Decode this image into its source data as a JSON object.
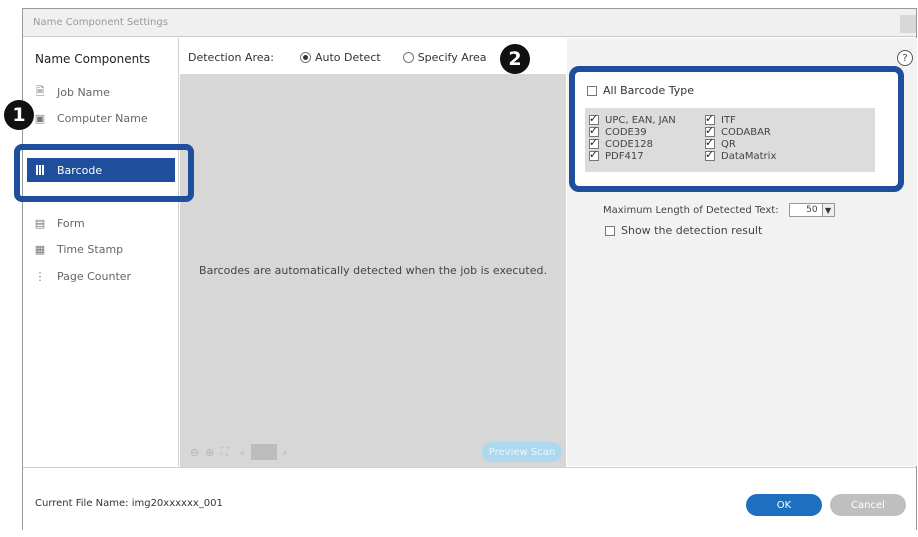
{
  "window": {
    "title": "Name Component Settings"
  },
  "sidebar": {
    "header": "Name Components",
    "items": [
      {
        "label": "Job Name",
        "icon": "document-icon"
      },
      {
        "label": "Computer Name",
        "icon": "computer-icon"
      },
      {
        "label": "Barcode",
        "icon": "barcode-icon",
        "selected": true
      },
      {
        "label": "Form",
        "icon": "form-icon"
      },
      {
        "label": "Time Stamp",
        "icon": "calendar-icon"
      },
      {
        "label": "Page Counter",
        "icon": "counter-icon"
      }
    ]
  },
  "detection": {
    "label": "Detection Area:",
    "options": [
      {
        "label": "Auto Detect",
        "selected": true
      },
      {
        "label": "Specify Area",
        "selected": false
      }
    ]
  },
  "preview": {
    "message": "Barcodes are automatically detected when the job is executed.",
    "scan_button": "Preview Scan"
  },
  "barcode_settings": {
    "all_types_label": "All Barcode Type",
    "all_types_checked": false,
    "types_left": [
      {
        "label": "UPC, EAN, JAN",
        "checked": true
      },
      {
        "label": "CODE39",
        "checked": true
      },
      {
        "label": "CODE128",
        "checked": true
      },
      {
        "label": "PDF417",
        "checked": true
      }
    ],
    "types_right": [
      {
        "label": "ITF",
        "checked": true
      },
      {
        "label": "CODABAR",
        "checked": true
      },
      {
        "label": "QR",
        "checked": true
      },
      {
        "label": "DataMatrix",
        "checked": true
      }
    ],
    "max_length_label": "Maximum Length of Detected Text:",
    "max_length_value": "50",
    "show_result_label": "Show the detection result",
    "show_result_checked": false
  },
  "footer": {
    "file_name": "Current File Name: img20xxxxxx_001",
    "ok_label": "OK",
    "cancel_label": "Cancel"
  },
  "callouts": {
    "first": "1",
    "second": "2"
  },
  "colors": {
    "accent": "#1f4e9c",
    "ok_button": "#1f6fc1",
    "preview_bg": "#d7d7d7"
  }
}
